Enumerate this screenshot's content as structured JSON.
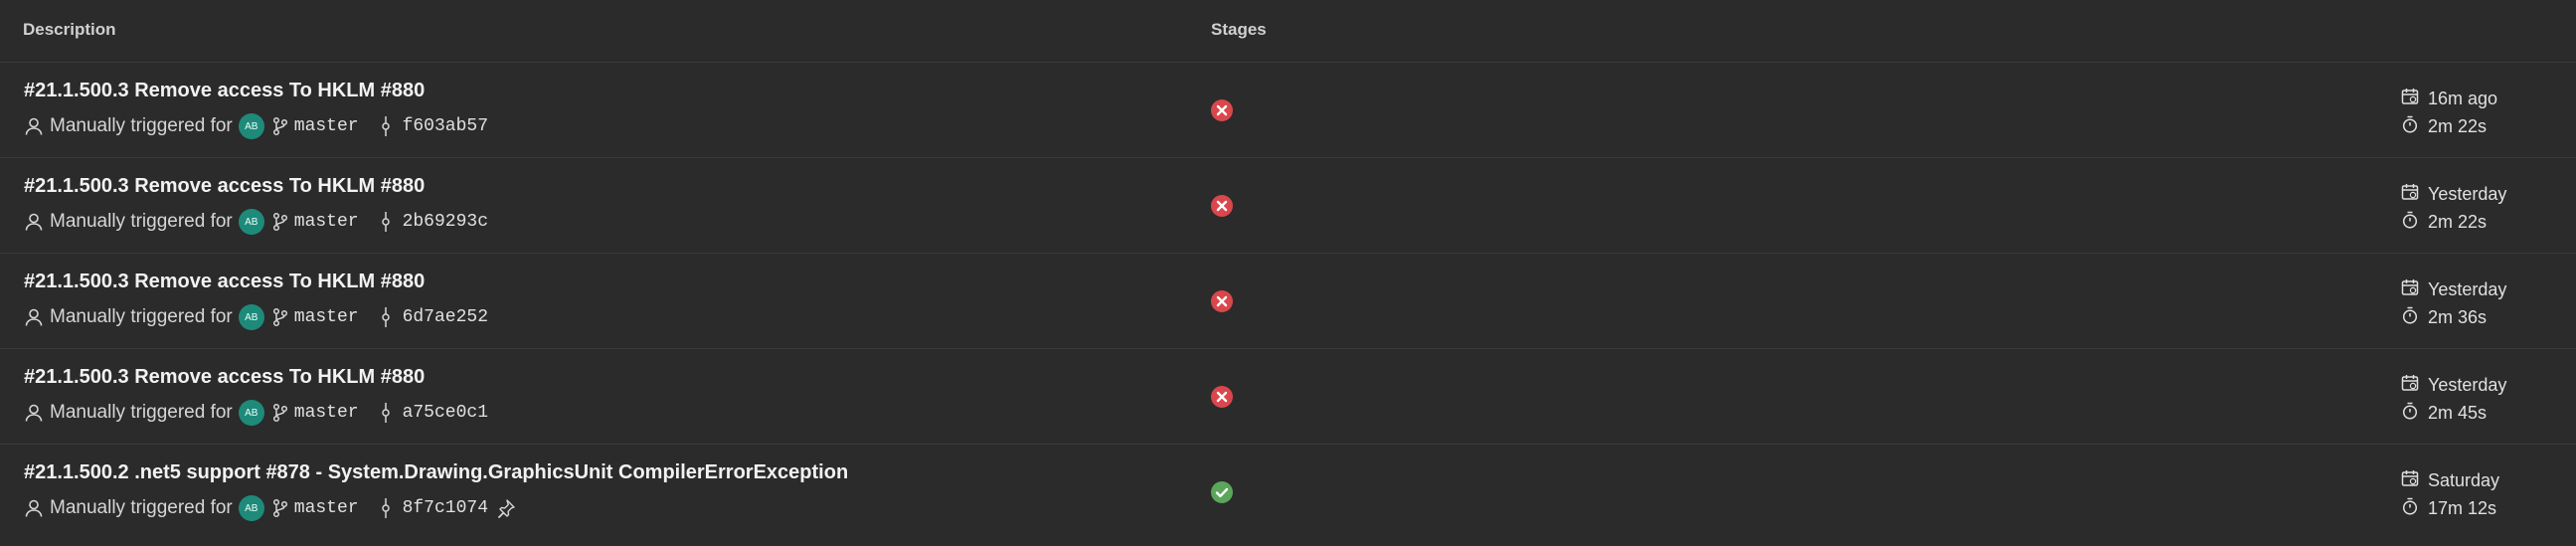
{
  "header": {
    "description": "Description",
    "stages": "Stages"
  },
  "colors": {
    "background": "#2b2b2b",
    "failed": "#d9474d",
    "succeeded": "#5aa65a",
    "avatar": "#1e8a7a"
  },
  "runs": [
    {
      "title": "#21.1.500.3 Remove access To HKLM #880",
      "trigger": "Manually triggered for",
      "avatar_initials": "AB",
      "branch": "master",
      "commit": "f603ab57",
      "status": "failed",
      "when": "16m ago",
      "duration": "2m 22s",
      "pinned": false
    },
    {
      "title": "#21.1.500.3 Remove access To HKLM #880",
      "trigger": "Manually triggered for",
      "avatar_initials": "AB",
      "branch": "master",
      "commit": "2b69293c",
      "status": "failed",
      "when": "Yesterday",
      "duration": "2m 22s",
      "pinned": false
    },
    {
      "title": "#21.1.500.3 Remove access To HKLM #880",
      "trigger": "Manually triggered for",
      "avatar_initials": "AB",
      "branch": "master",
      "commit": "6d7ae252",
      "status": "failed",
      "when": "Yesterday",
      "duration": "2m 36s",
      "pinned": false
    },
    {
      "title": "#21.1.500.3 Remove access To HKLM #880",
      "trigger": "Manually triggered for",
      "avatar_initials": "AB",
      "branch": "master",
      "commit": "a75ce0c1",
      "status": "failed",
      "when": "Yesterday",
      "duration": "2m 45s",
      "pinned": false
    },
    {
      "title": "#21.1.500.2 .net5 support #878 - System.Drawing.GraphicsUnit CompilerErrorException",
      "trigger": "Manually triggered for",
      "avatar_initials": "AB",
      "branch": "master",
      "commit": "8f7c1074",
      "status": "succeeded",
      "when": "Saturday",
      "duration": "17m 12s",
      "pinned": true
    }
  ]
}
